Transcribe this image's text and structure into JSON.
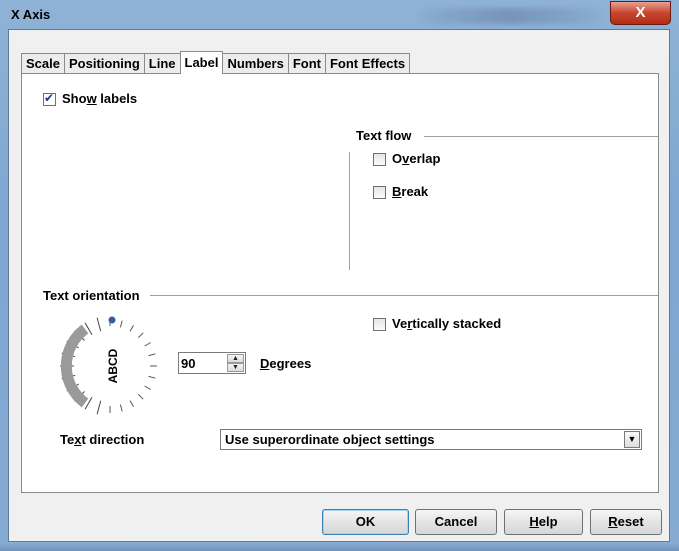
{
  "window": {
    "title": "X Axis",
    "close_glyph": "X"
  },
  "tabs": [
    {
      "label": "Scale",
      "active": false
    },
    {
      "label": "Positioning",
      "active": false
    },
    {
      "label": "Line",
      "active": false
    },
    {
      "label": "Label",
      "active": true
    },
    {
      "label": "Numbers",
      "active": false
    },
    {
      "label": "Font",
      "active": false
    },
    {
      "label": "Font Effects",
      "active": false
    }
  ],
  "show_labels": {
    "pre": "Sho",
    "mn": "w",
    "post": " labels",
    "checked": true
  },
  "text_flow": {
    "heading": "Text flow",
    "overlap": {
      "pre": "O",
      "mn": "v",
      "post": "erlap",
      "checked": false
    },
    "break": {
      "pre": "",
      "mn": "B",
      "post": "reak",
      "checked": false
    }
  },
  "text_orientation": {
    "heading": "Text orientation",
    "dial_text": "ABCD",
    "degrees_value": "90",
    "degrees_label": {
      "pre": "",
      "mn": "D",
      "post": "egrees"
    },
    "vertically_stacked": {
      "pre": "Ve",
      "mn": "r",
      "post": "tically stacked",
      "checked": false
    }
  },
  "text_direction": {
    "label": {
      "pre": "Te",
      "mn": "x",
      "post": "t direction"
    },
    "selected": "Use superordinate object settings"
  },
  "buttons": {
    "ok": "OK",
    "cancel": "Cancel",
    "help": {
      "pre": "",
      "mn": "H",
      "post": "elp"
    },
    "reset": {
      "pre": "",
      "mn": "R",
      "post": "eset"
    }
  },
  "colors": {
    "dial_accent": "#3b5ba0",
    "title_bar": "#8fb3d6",
    "close_button": "#c7462f"
  }
}
